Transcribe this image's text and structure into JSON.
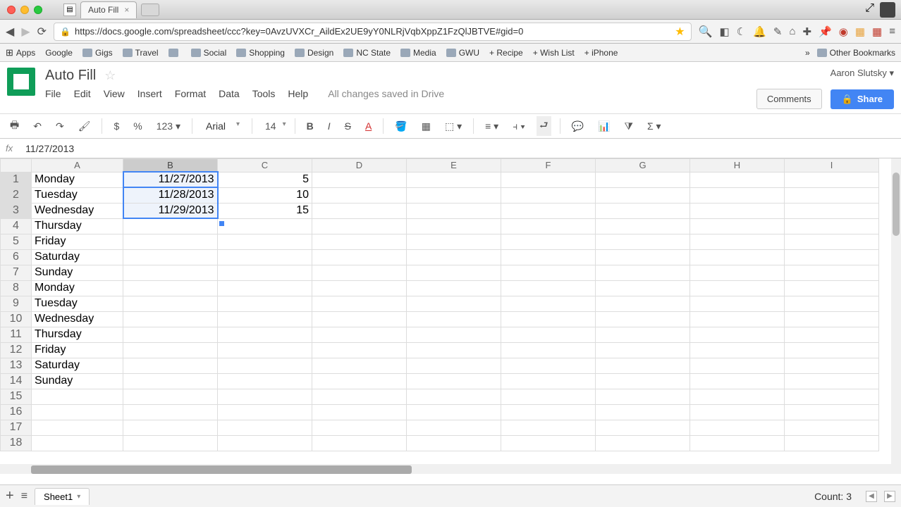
{
  "browser": {
    "tab_title": "Auto Fill",
    "url": "https://docs.google.com/spreadsheet/ccc?key=0AvzUVXCr_AildEx2UE9yY0NLRjVqbXppZ1FzQlJBTVE#gid=0",
    "apps_label": "Apps",
    "bookmarks": [
      "Google",
      "Gigs",
      "Travel",
      "",
      "Social",
      "Shopping",
      "Design",
      "NC State",
      "Media",
      "GWU",
      "+ Recipe",
      "+ Wish List",
      "+ iPhone"
    ],
    "other_bookmarks": "Other Bookmarks"
  },
  "docs": {
    "title": "Auto Fill",
    "menus": [
      "File",
      "Edit",
      "View",
      "Insert",
      "Format",
      "Data",
      "Tools",
      "Help"
    ],
    "save_status": "All changes saved in Drive",
    "user": "Aaron Slutsky",
    "comments_label": "Comments",
    "share_label": "Share"
  },
  "toolbar": {
    "currency": "$",
    "percent": "%",
    "number_format": "123",
    "font_family": "Arial",
    "font_size": "14"
  },
  "formula_bar": {
    "fx_label": "fx",
    "value": "11/27/2013"
  },
  "grid": {
    "columns": [
      "A",
      "B",
      "C",
      "D",
      "E",
      "F",
      "G",
      "H",
      "I"
    ],
    "row_count": 18,
    "selected_col": "B",
    "selected_rows": [
      1,
      2,
      3
    ],
    "cells": {
      "A": [
        "Monday",
        "Tuesday",
        "Wednesday",
        "Thursday",
        "Friday",
        "Saturday",
        "Sunday",
        "Monday",
        "Tuesday",
        "Wednesday",
        "Thursday",
        "Friday",
        "Saturday",
        "Sunday",
        "",
        "",
        "",
        ""
      ],
      "B": [
        "11/27/2013",
        "11/28/2013",
        "11/29/2013",
        "",
        "",
        "",
        "",
        "",
        "",
        "",
        "",
        "",
        "",
        "",
        "",
        "",
        "",
        ""
      ],
      "C": [
        "5",
        "10",
        "15",
        "",
        "",
        "",
        "",
        "",
        "",
        "",
        "",
        "",
        "",
        "",
        "",
        "",
        "",
        ""
      ]
    }
  },
  "sheet_tabs": {
    "active": "Sheet1"
  },
  "status_bar": {
    "text": "Count: 3"
  }
}
